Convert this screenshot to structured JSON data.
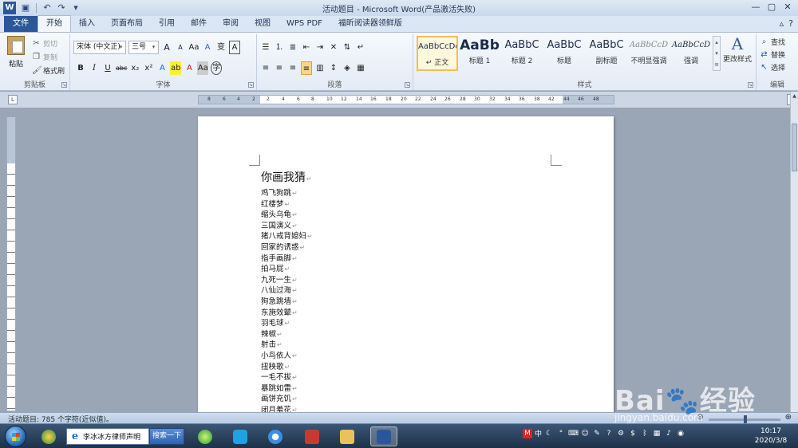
{
  "window": {
    "title": "活动题目 - Microsoft Word(产品激活失败)",
    "app_icon": "W"
  },
  "tabs": [
    {
      "label": "文件"
    },
    {
      "label": "开始"
    },
    {
      "label": "插入"
    },
    {
      "label": "页面布局"
    },
    {
      "label": "引用"
    },
    {
      "label": "邮件"
    },
    {
      "label": "审阅"
    },
    {
      "label": "视图"
    },
    {
      "label": "WPS PDF"
    },
    {
      "label": "福昕阅读器领鲜版"
    }
  ],
  "ribbon": {
    "clipboard": {
      "label": "剪贴板",
      "paste": "粘贴",
      "cut": "剪切",
      "copy": "复制",
      "format_painter": "格式刷"
    },
    "font": {
      "label": "字体",
      "font_name": "宋体 (中文正)",
      "font_size": "三号",
      "grow": "A",
      "shrink": "A",
      "change_case": "Aa",
      "clear": "A",
      "pinyin": "变",
      "border": "A",
      "bold": "B",
      "italic": "I",
      "underline": "U",
      "strike": "abc",
      "subscript": "x₂",
      "superscript": "x²",
      "effects": "A",
      "highlight": "ab",
      "color": "A",
      "char_shade": "Aa",
      "enclose": "字"
    },
    "paragraph": {
      "label": "段落"
    },
    "styles": {
      "label": "样式",
      "items": [
        {
          "sample": "AaBbCcDd",
          "name": "↵ 正文"
        },
        {
          "sample": "AaBb",
          "name": "标题 1"
        },
        {
          "sample": "AaBbC",
          "name": "标题 2"
        },
        {
          "sample": "AaBbC",
          "name": "标题"
        },
        {
          "sample": "AaBbC",
          "name": "副标题"
        },
        {
          "sample": "AaBbCcD",
          "name": "不明显强调"
        },
        {
          "sample": "AaBbCcD",
          "name": "强调"
        }
      ],
      "change_styles": "更改样式"
    },
    "editing": {
      "label": "编辑",
      "find": "查找",
      "replace": "替换",
      "select": "选择"
    }
  },
  "ruler": {
    "ticks": [
      "8",
      "6",
      "4",
      "2",
      "2",
      "4",
      "6",
      "8",
      "10",
      "12",
      "14",
      "16",
      "18",
      "20",
      "22",
      "24",
      "26",
      "28",
      "30",
      "32",
      "34",
      "36",
      "38",
      "42",
      "44",
      "46",
      "48"
    ]
  },
  "document": {
    "title": "你画我猜",
    "lines": [
      "鸡飞狗跳",
      "红楼梦",
      "缩头乌龟",
      "三国演义",
      "猪八戒背媳妇",
      "回家的诱惑",
      "指手画脚",
      "拍马屁",
      "九死一生",
      "八仙过海",
      "狗急跳墙",
      "东施效颦",
      "羽毛球",
      "辣椒",
      "射击",
      "小鸟依人",
      "扭秧歌",
      "一毛不拔",
      "暴跳如雷",
      "画饼充饥",
      "闭月羞花"
    ]
  },
  "statusbar": {
    "text": "活动题目: 785 个字符(近似值)。"
  },
  "taskbar": {
    "ie_text": "李冰冰方律师声明",
    "search_button": "搜索一下",
    "tray_text": "中",
    "time": "10:17",
    "date": "2020/3/8"
  },
  "watermark": {
    "text": "Bai🐾经验",
    "url": "jingyan.baidu.com"
  },
  "colors": {
    "file_tab": "#2b579a",
    "ribbon_bg": "#e3ebf6",
    "workspace": "#9aa5b5"
  }
}
